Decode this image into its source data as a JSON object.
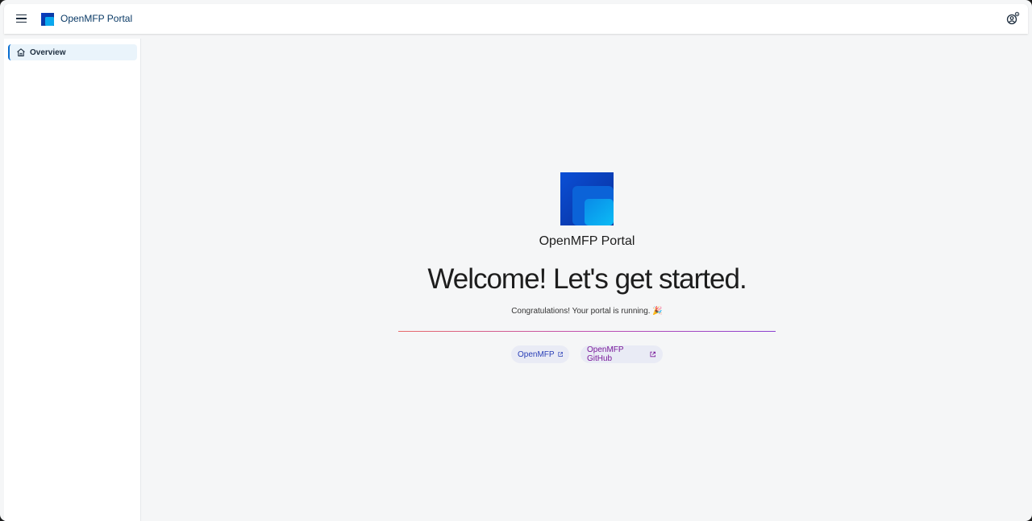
{
  "header": {
    "app_title": "OpenMFP Portal",
    "menu_icon": "hamburger-menu-icon",
    "profile_icon": "user-profile-icon"
  },
  "sidebar": {
    "items": [
      {
        "label": "Overview",
        "icon": "home-icon",
        "selected": true
      }
    ]
  },
  "main": {
    "portal_name": "OpenMFP Portal",
    "heading": "Welcome! Let's get started.",
    "subtitle": "Congratulations! Your portal is running. 🎉",
    "links": [
      {
        "label": "OpenMFP",
        "icon": "external-link-icon"
      },
      {
        "label": "OpenMFP GitHub",
        "icon": "external-link-icon"
      }
    ]
  },
  "colors": {
    "brand_blue": "#0a3a66",
    "accent": "#0a6ed1",
    "link_blue": "#2a3fb7",
    "link_purple": "#7a1a9a"
  }
}
